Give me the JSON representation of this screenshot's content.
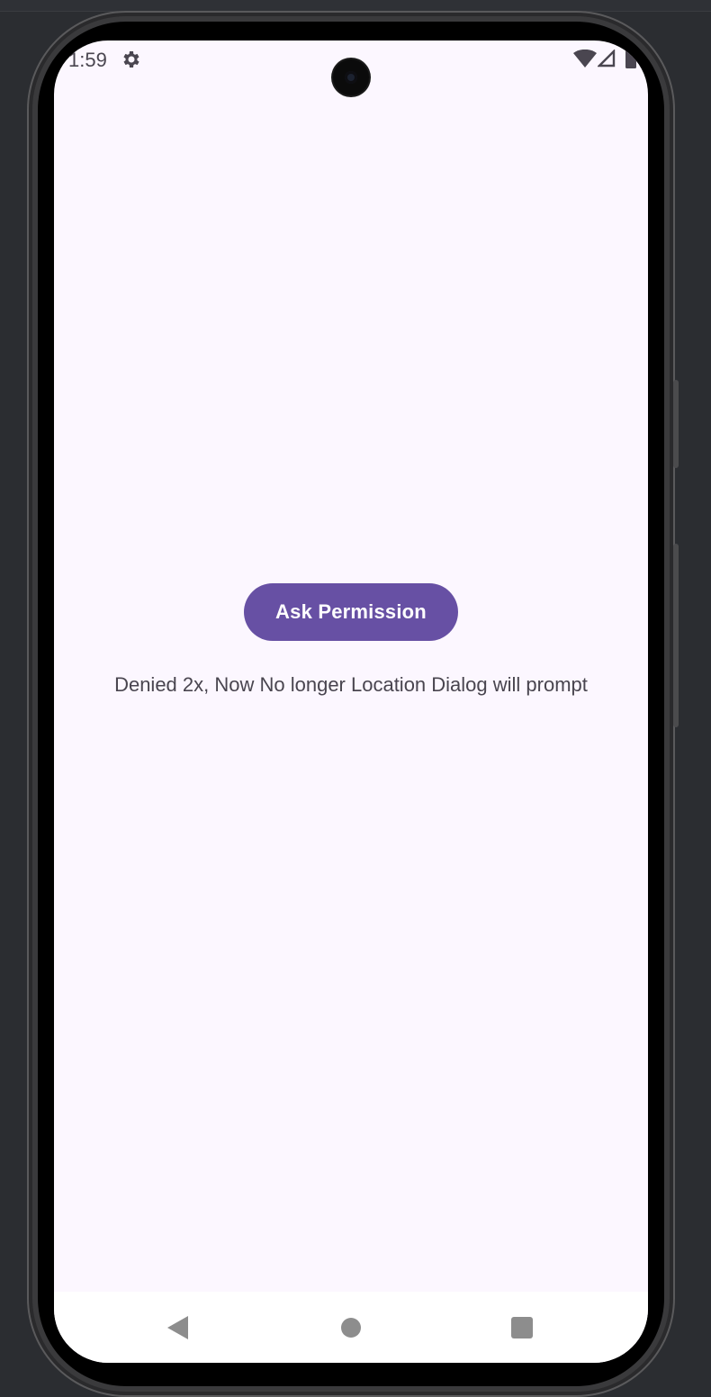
{
  "status_bar": {
    "time": "1:59",
    "icons": [
      "gear-icon",
      "wifi-icon",
      "signal-icon",
      "battery-icon"
    ]
  },
  "main": {
    "button_label": "Ask Permission",
    "message": "Denied 2x, Now No longer Location Dialog will prompt"
  },
  "nav_bar": {
    "icons": [
      "back-icon",
      "home-icon",
      "recents-icon"
    ]
  },
  "colors": {
    "primary": "#6750a4",
    "background": "#fcf7ff",
    "text": "#49454f"
  }
}
